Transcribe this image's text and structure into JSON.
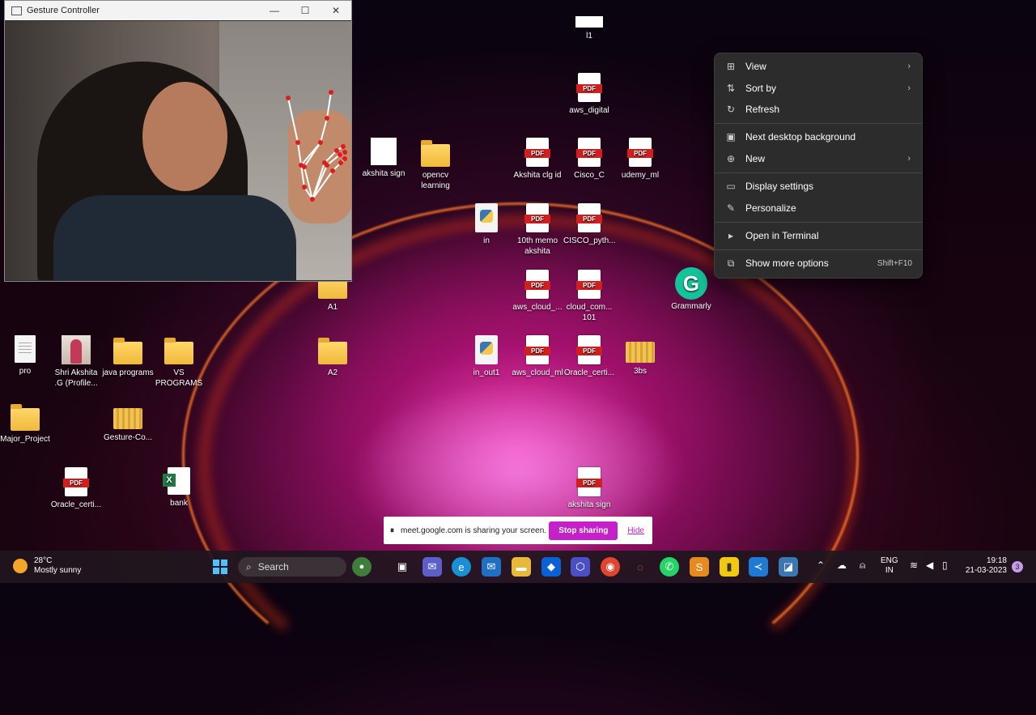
{
  "gesture_window": {
    "title": "Gesture Controller",
    "minimize_glyph": "—",
    "maximize_glyph": "☐",
    "close_glyph": "✕"
  },
  "desktop_icons": {
    "l1": "l1",
    "aws_digital": "aws_digital",
    "akshita_sign": "akshita sign",
    "opencv_learning": "opencv learning",
    "akshita_clg_id": "Akshita clg id",
    "cisco_c": "Cisco_C",
    "udemy_ml": "udemy_ml",
    "in": "in",
    "memo": "10th memo akshita",
    "cisco_pyth": "CISCO_pyth...",
    "a1": "A1",
    "aws_cloud_": "aws_cloud_...",
    "cloud_com": "cloud_com... 101",
    "grammarly": "Grammarly",
    "pro": "pro",
    "shri_akshita": "Shri Akshita .G (Profile...",
    "java_programs": "java programs",
    "vs_programs": "VS PROGRAMS",
    "a2": "A2",
    "in_out1": "in_out1",
    "aws_cloud_ml": "aws_cloud_ml",
    "oracle_certi_2": "Oracle_certi...",
    "3bs": "3bs",
    "major_project": "Major_Project",
    "gesture_co": "Gesture-Co...",
    "oracle_certi": "Oracle_certi...",
    "bank": "bank",
    "akshita_sign_pdf": "akshita sign"
  },
  "context_menu": {
    "view": "View",
    "sort_by": "Sort by",
    "refresh": "Refresh",
    "next_bg": "Next desktop background",
    "new": "New",
    "display_settings": "Display settings",
    "personalize": "Personalize",
    "open_terminal": "Open in Terminal",
    "show_more": "Show more options",
    "show_more_shortcut": "Shift+F10"
  },
  "sharing_bar": {
    "message": "meet.google.com is sharing your screen.",
    "stop_label": "Stop sharing",
    "hide_label": "Hide"
  },
  "taskbar": {
    "temperature": "28°C",
    "condition": "Mostly sunny",
    "search_label": "Search",
    "lang_line1": "ENG",
    "lang_line2": "IN",
    "time": "19:18",
    "date": "21-03-2023",
    "notification_count": "3"
  },
  "colors": {
    "accent_magenta": "#c521c8",
    "pdf_red": "#d11f1f",
    "grammarly_green": "#15c39a",
    "menu_bg": "#2c2c2c"
  }
}
